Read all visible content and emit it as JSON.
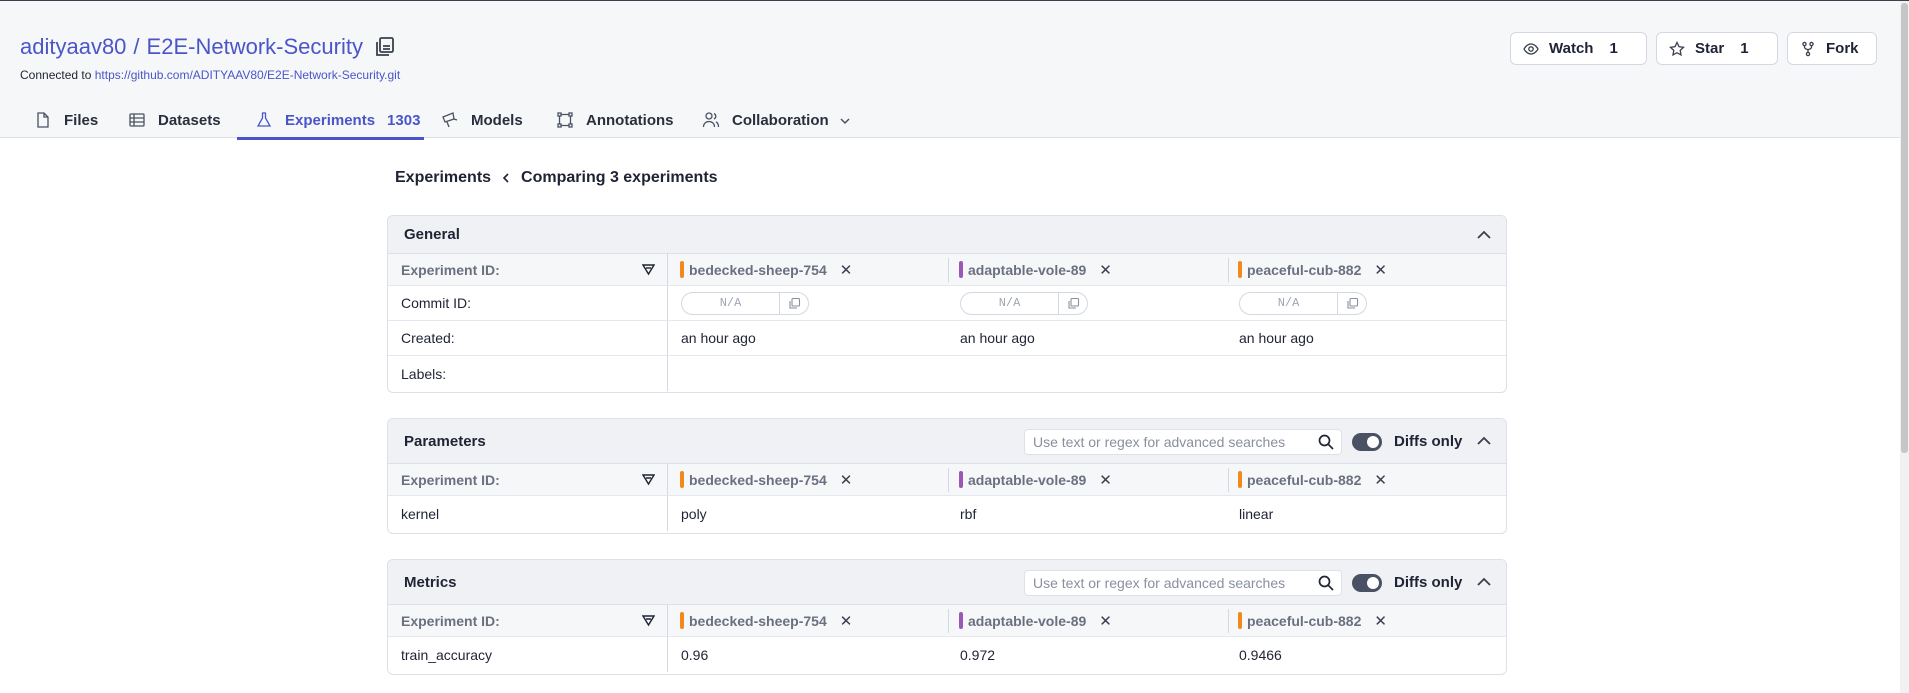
{
  "repo": {
    "owner": "adityaav80",
    "separator": "/",
    "name": "E2E-Network-Security",
    "connected_prefix": "Connected to",
    "connected_url": "https://github.com/ADITYAAV80/E2E-Network-Security.git"
  },
  "actions": {
    "watch_label": "Watch",
    "watch_count": "1",
    "star_label": "Star",
    "star_count": "1",
    "fork_label": "Fork"
  },
  "tabs": [
    {
      "label": "Files",
      "icon": "file-icon"
    },
    {
      "label": "Datasets",
      "icon": "dataset-icon"
    },
    {
      "label": "Experiments",
      "icon": "flask-icon",
      "count": "1303",
      "active": true
    },
    {
      "label": "Models",
      "icon": "model-icon"
    },
    {
      "label": "Annotations",
      "icon": "annotation-icon"
    },
    {
      "label": "Collaboration",
      "icon": "users-icon"
    }
  ],
  "breadcrumb": {
    "root": "Experiments",
    "current": "Comparing 3 experiments"
  },
  "experiments": [
    {
      "name": "bedecked-sheep-754",
      "color": "#f28a1b"
    },
    {
      "name": "adaptable-vole-89",
      "color": "#9b59b6"
    },
    {
      "name": "peaceful-cub-882",
      "color": "#f28a1b"
    }
  ],
  "general": {
    "title": "General",
    "id_label": "Experiment ID:",
    "commit_label": "Commit ID:",
    "commit_values": [
      "N/A",
      "N/A",
      "N/A"
    ],
    "created_label": "Created:",
    "created_values": [
      "an hour ago",
      "an hour ago",
      "an hour ago"
    ],
    "labels_label": "Labels:"
  },
  "parameters": {
    "title": "Parameters",
    "search_placeholder": "Use text or regex for advanced searches",
    "diffs_label": "Diffs only",
    "id_label": "Experiment ID:",
    "rows": [
      {
        "key": "kernel",
        "values": [
          "poly",
          "rbf",
          "linear"
        ]
      }
    ]
  },
  "metrics": {
    "title": "Metrics",
    "search_placeholder": "Use text or regex for advanced searches",
    "diffs_label": "Diffs only",
    "id_label": "Experiment ID:",
    "rows": [
      {
        "key": "train_accuracy",
        "values": [
          "0.96",
          "0.972",
          "0.9466"
        ]
      }
    ]
  }
}
